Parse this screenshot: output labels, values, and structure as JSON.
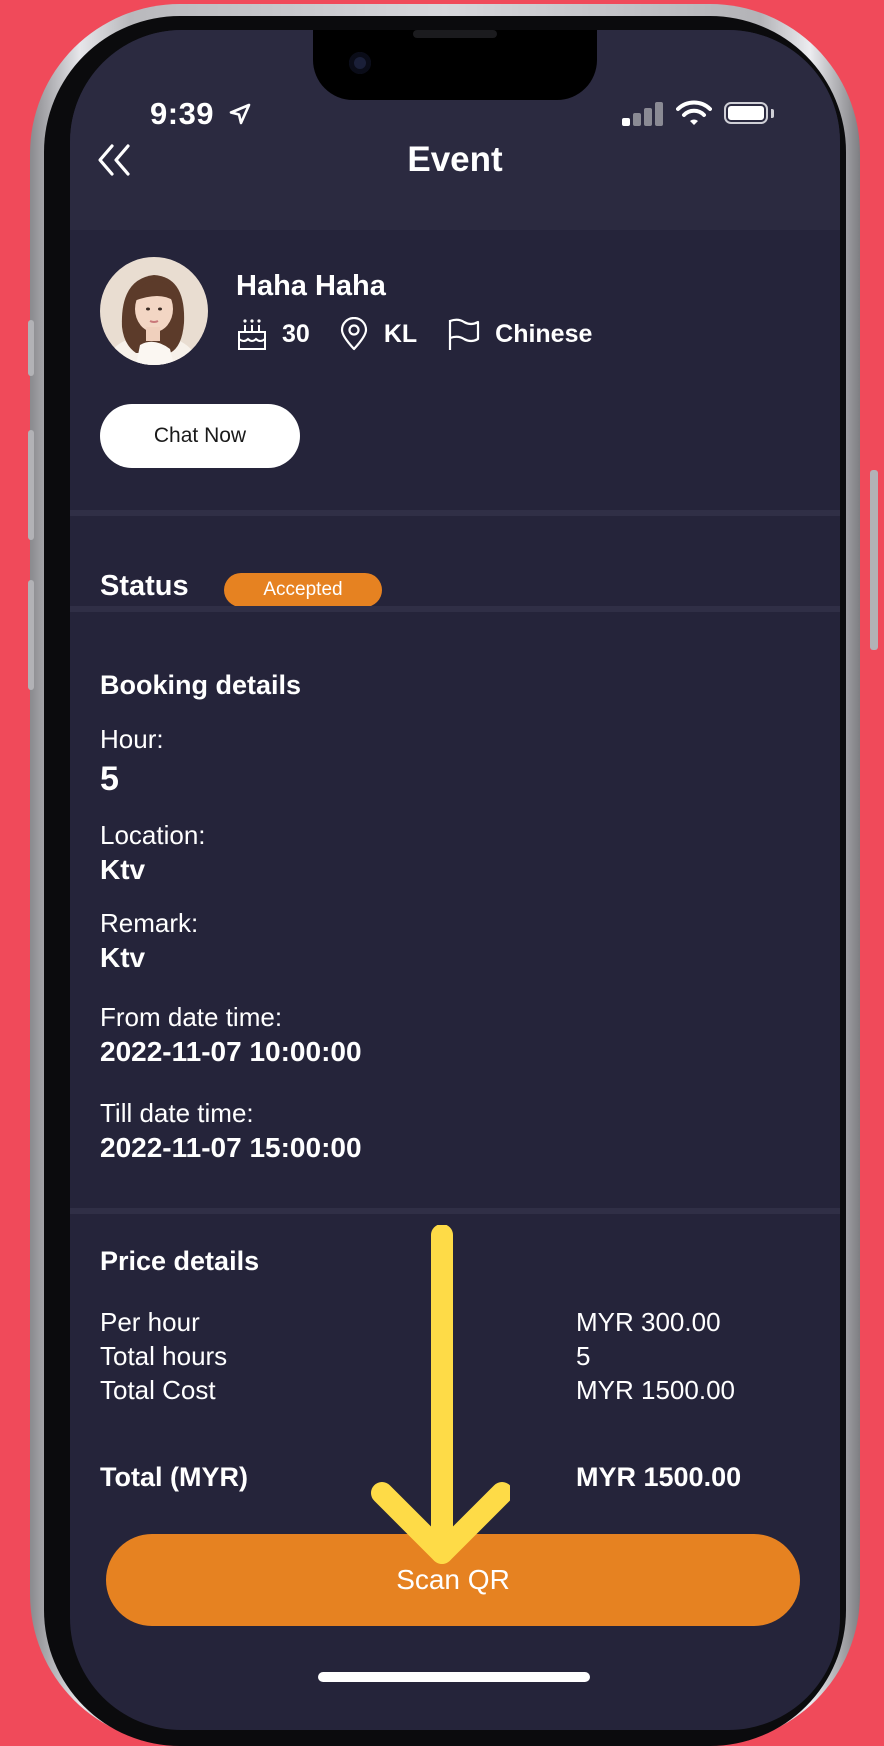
{
  "status_bar": {
    "time": "9:39"
  },
  "header": {
    "title": "Event"
  },
  "profile": {
    "name": "Haha Haha",
    "age": "30",
    "location": "KL",
    "language": "Chinese",
    "chat_label": "Chat Now"
  },
  "status": {
    "label": "Status",
    "badge": "Accepted"
  },
  "booking": {
    "title": "Booking details",
    "hour_label": "Hour:",
    "hour_value": "5",
    "location_label": "Location:",
    "location_value": "Ktv",
    "remark_label": "Remark:",
    "remark_value": "Ktv",
    "from_label": "From date time:",
    "from_value": "2022-11-07 10:00:00",
    "till_label": "Till date time:",
    "till_value": "2022-11-07 15:00:00"
  },
  "price": {
    "title": "Price details",
    "rows": [
      {
        "label": "Per hour",
        "value": "MYR 300.00"
      },
      {
        "label": "Total hours",
        "value": "5"
      },
      {
        "label": "Total Cost",
        "value": "MYR 1500.00"
      }
    ],
    "total_label": "Total (MYR)",
    "total_value": "MYR 1500.00"
  },
  "actions": {
    "scan_label": "Scan QR"
  },
  "colors": {
    "background": "#f04a5a",
    "screen": "#25243a",
    "accent": "#e68221",
    "arrow": "#fedb47"
  }
}
